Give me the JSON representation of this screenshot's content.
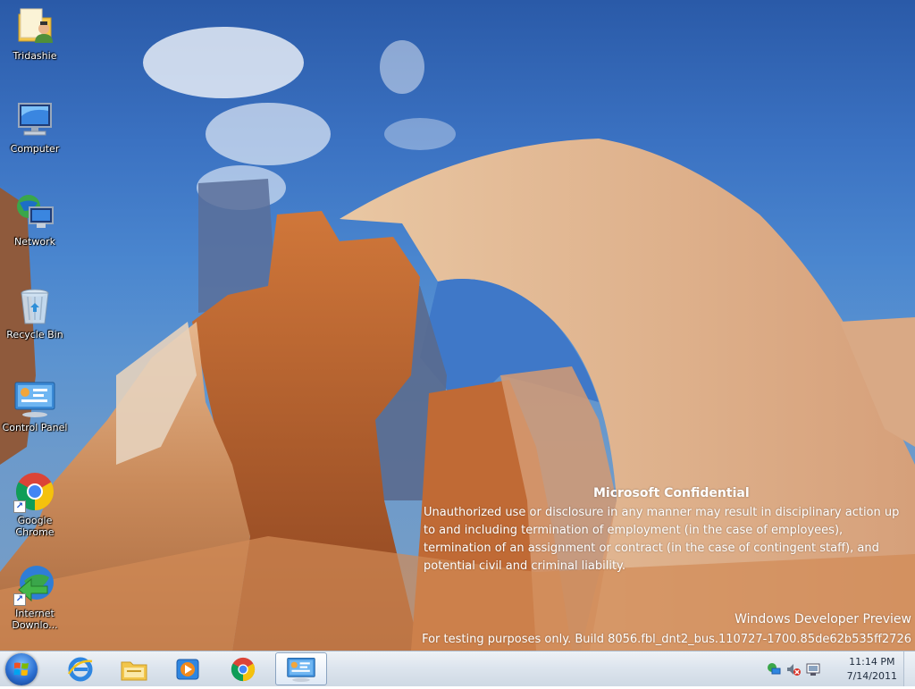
{
  "desktop_icons": [
    {
      "label": "Tridashie",
      "icon": "user-folder-icon"
    },
    {
      "label": "Computer",
      "icon": "computer-icon"
    },
    {
      "label": "Network",
      "icon": "network-icon"
    },
    {
      "label": "Recycle Bin",
      "icon": "recycle-bin-icon"
    },
    {
      "label": "Control Panel",
      "icon": "control-panel-icon"
    },
    {
      "label": "Google Chrome",
      "icon": "chrome-icon"
    },
    {
      "label": "Internet Downlo...",
      "icon": "internet-download-manager-icon"
    }
  ],
  "watermark": {
    "title": "Microsoft Confidential",
    "lines": [
      "Unauthorized use or disclosure in any manner may result in disciplinary action up",
      "to and including termination of employment (in the case of employees),",
      "termination of an assignment or contract (in the case of contingent staff), and",
      "potential civil and criminal liability."
    ],
    "product": "Windows Developer Preview",
    "build": "For testing purposes only. Build 8056.fbl_dnt2_bus.110727-1700.85de62b535ff2726"
  },
  "taskbar": {
    "start_icon": "windows-start-orb-icon",
    "pinned": [
      {
        "icon": "internet-explorer-icon"
      },
      {
        "icon": "file-explorer-icon"
      },
      {
        "icon": "media-player-icon"
      },
      {
        "icon": "chrome-icon"
      },
      {
        "icon": "control-panel-icon",
        "active": true
      }
    ],
    "tray": {
      "icons": [
        "network-status-icon",
        "volume-muted-icon",
        "action-center-icon"
      ],
      "time": "11:14 PM",
      "date": "7/14/2011"
    }
  },
  "colors": {
    "sky": "#3b72c2",
    "rock": "#c98a5a",
    "taskbar": "#dde5ee",
    "clock_text": "#1e2b3c"
  }
}
